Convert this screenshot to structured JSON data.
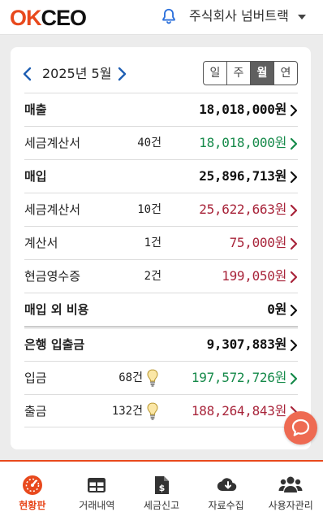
{
  "header": {
    "logo_ok": "OK",
    "logo_ceo": "CEO",
    "company": "주식회사 넘버트랙"
  },
  "period": {
    "label": "2025년 5월",
    "segments": [
      "일",
      "주",
      "월",
      "연"
    ],
    "active_segment": "월"
  },
  "rows": [
    {
      "label": "매출",
      "count": "",
      "count_unit": "",
      "amount": "18,018,000",
      "unit": "원",
      "style": "head"
    },
    {
      "label": "세금계산서",
      "count": "40",
      "count_unit": "건",
      "amount": "18,018,000",
      "unit": "원",
      "style": "green"
    },
    {
      "label": "매입",
      "count": "",
      "count_unit": "",
      "amount": "25,896,713",
      "unit": "원",
      "style": "head"
    },
    {
      "label": "세금계산서",
      "count": "10",
      "count_unit": "건",
      "amount": "25,622,663",
      "unit": "원",
      "style": "red"
    },
    {
      "label": "계산서",
      "count": "1",
      "count_unit": "건",
      "amount": "75,000",
      "unit": "원",
      "style": "red"
    },
    {
      "label": "현금영수증",
      "count": "2",
      "count_unit": "건",
      "amount": "199,050",
      "unit": "원",
      "style": "red"
    },
    {
      "label": "매입 외 비용",
      "count": "",
      "count_unit": "",
      "amount": "0",
      "unit": "원",
      "style": "head"
    },
    {
      "label": "은행 입출금",
      "count": "",
      "count_unit": "",
      "amount": "9,307,883",
      "unit": "원",
      "style": "head"
    },
    {
      "label": "입금",
      "count": "68",
      "count_unit": "건",
      "amount": "197,572,726",
      "unit": "원",
      "style": "green"
    },
    {
      "label": "출금",
      "count": "132",
      "count_unit": "건",
      "amount": "188,264,843",
      "unit": "원",
      "style": "red"
    }
  ],
  "tabs": [
    {
      "label": "현황판",
      "icon": "dashboard-icon",
      "active": true
    },
    {
      "label": "거래내역",
      "icon": "table-icon",
      "active": false
    },
    {
      "label": "세금신고",
      "icon": "tax-file-icon",
      "active": false
    },
    {
      "label": "자료수집",
      "icon": "cloud-download-icon",
      "active": false
    },
    {
      "label": "사용자관리",
      "icon": "users-icon",
      "active": false
    }
  ],
  "colors": {
    "brand": "#e8491d",
    "income_green": "#168a4a",
    "expense_red": "#a8243a",
    "chat_button": "#ee6a52"
  }
}
